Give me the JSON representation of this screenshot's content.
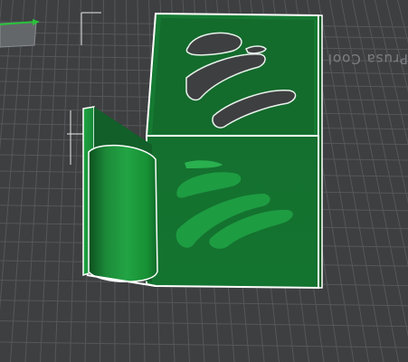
{
  "scene": {
    "bed_label": "Prusa Cool",
    "bed_color": "#3e3f41",
    "grid_color": "#55575a",
    "model_color": "#1d8f3c",
    "model_dark": "#0f5a26",
    "model_outline": "#ffffff",
    "axis_x_color": "#29c23a"
  }
}
